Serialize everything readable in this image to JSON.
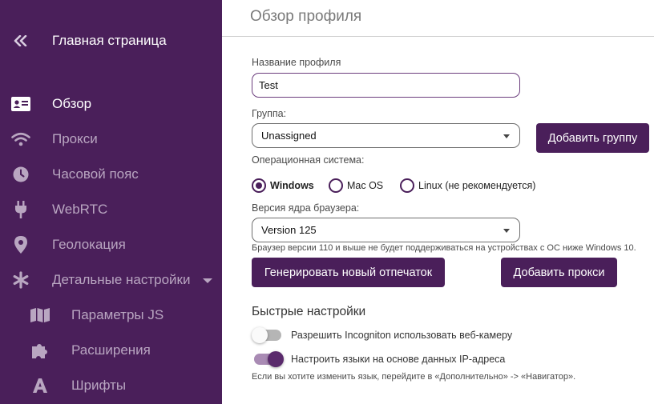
{
  "colors": {
    "sidebar_bg": "#4a1f5a",
    "accent": "#4a1f5a",
    "sidebar_text": "#b9a6c1",
    "sidebar_active_text": "#ffffff"
  },
  "sidebar": {
    "home": {
      "label": "Главная страница",
      "icon": "double-chevron-left-icon"
    },
    "items": [
      {
        "label": "Обзор",
        "icon": "id-card-icon",
        "active": true
      },
      {
        "label": "Прокси",
        "icon": "wifi-icon"
      },
      {
        "label": "Часовой пояс",
        "icon": "clock-icon"
      },
      {
        "label": "WebRTC",
        "icon": "plug-icon"
      },
      {
        "label": "Геолокация",
        "icon": "map-pin-icon"
      },
      {
        "label": "Детальные настройки",
        "icon": "asterisk-icon",
        "expanded": true
      },
      {
        "label": "Параметры JS",
        "icon": "map-icon"
      },
      {
        "label": "Расширения",
        "icon": "puzzle-icon"
      },
      {
        "label": "Шрифты",
        "icon": "font-icon"
      }
    ]
  },
  "main": {
    "title": "Обзор профиля",
    "profile_name": {
      "label": "Название профиля",
      "value": "Test"
    },
    "group": {
      "label": "Группа:",
      "value": "Unassigned",
      "add_button": "Добавить группу"
    },
    "os": {
      "label": "Операционная система:",
      "options": [
        "Windows",
        "Mac OS",
        "Linux (не рекомендуется)"
      ],
      "selected": "Windows"
    },
    "browser_core": {
      "label": "Версия ядра браузера:",
      "value": "Version 125",
      "hint": "Браузер версии 110 и выше не будет поддерживаться на устройствах с ОС ниже Windows 10."
    },
    "buttons": {
      "generate": "Генерировать новый отпечаток",
      "add_proxy": "Добавить прокси"
    },
    "quick": {
      "title": "Быстрые настройки",
      "toggles": [
        {
          "label": "Разрешить Incogniton использовать веб-камеру",
          "on": false
        },
        {
          "label": "Настроить языки на основе данных IP-адреса",
          "on": true
        }
      ],
      "note": "Если вы хотите изменить язык, перейдите в «Дополнительно» -> «Навигатор»."
    }
  }
}
